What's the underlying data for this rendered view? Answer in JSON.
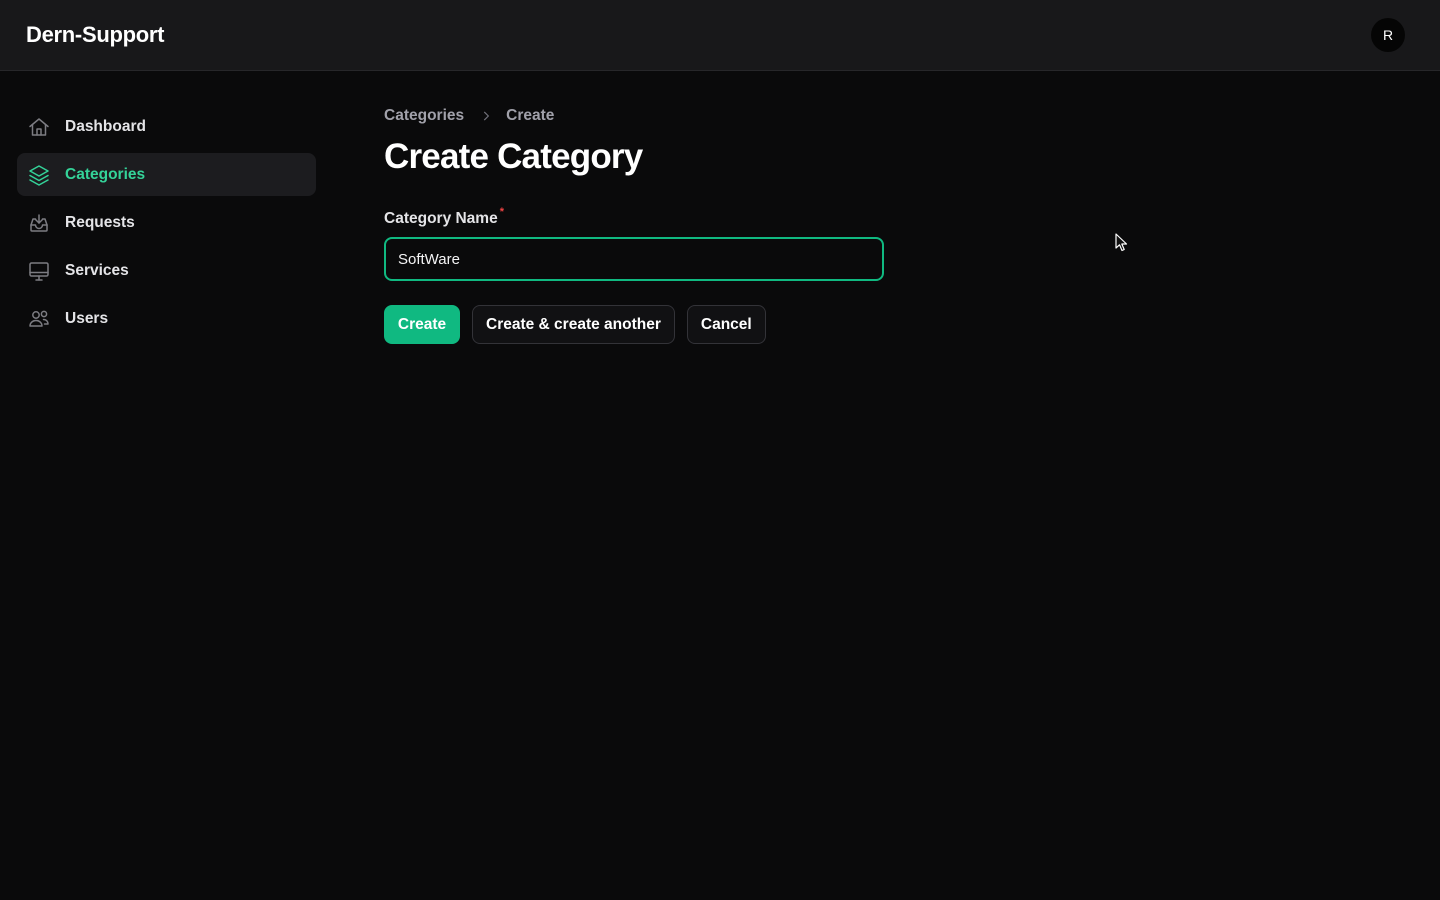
{
  "app": {
    "title": "Dern-Support",
    "avatar_initial": "R"
  },
  "sidebar": {
    "items": [
      {
        "label": "Dashboard",
        "icon": "home-icon",
        "active": false
      },
      {
        "label": "Categories",
        "icon": "stack-icon",
        "active": true
      },
      {
        "label": "Requests",
        "icon": "inbox-icon",
        "active": false
      },
      {
        "label": "Services",
        "icon": "monitor-icon",
        "active": false
      },
      {
        "label": "Users",
        "icon": "users-icon",
        "active": false
      }
    ]
  },
  "breadcrumb": {
    "parent": "Categories",
    "current": "Create"
  },
  "page": {
    "title": "Create Category"
  },
  "form": {
    "category_name": {
      "label": "Category Name",
      "required_marker": "*",
      "value": "SoftWare"
    }
  },
  "actions": {
    "create": "Create",
    "create_another": "Create & create another",
    "cancel": "Cancel"
  },
  "colors": {
    "accent": "#10b981",
    "active_text": "#34d399",
    "required": "#ef4444"
  }
}
